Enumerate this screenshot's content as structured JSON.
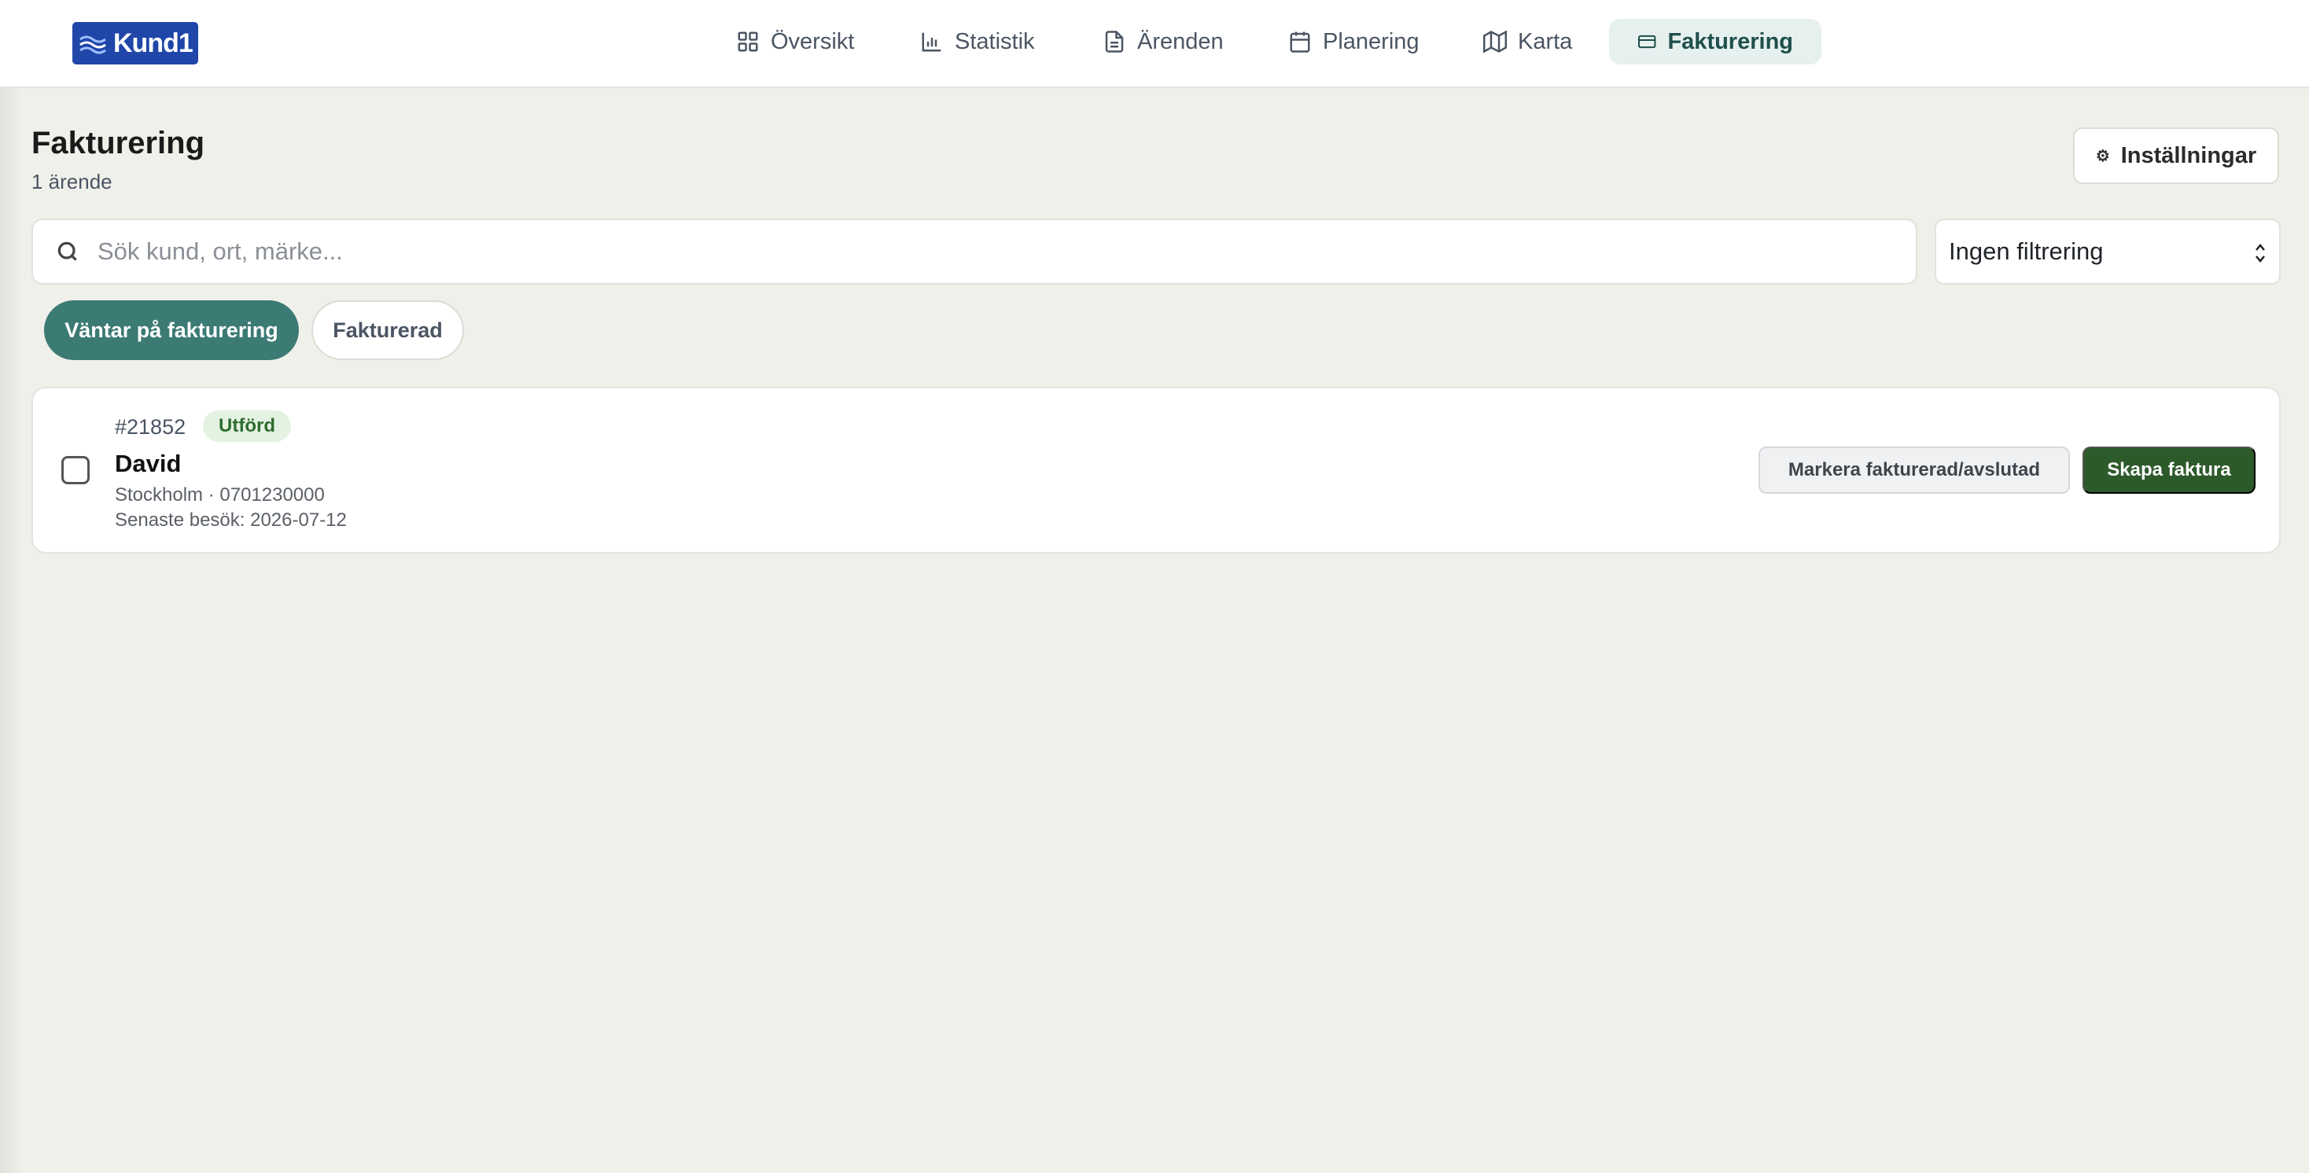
{
  "app": {
    "logo_text": "Kund1"
  },
  "nav": {
    "items": [
      {
        "label": "Översikt",
        "icon": "grid-icon"
      },
      {
        "label": "Statistik",
        "icon": "bar-chart-icon"
      },
      {
        "label": "Ärenden",
        "icon": "document-icon"
      },
      {
        "label": "Planering",
        "icon": "calendar-icon"
      },
      {
        "label": "Karta",
        "icon": "map-icon"
      },
      {
        "label": "Fakturering",
        "icon": "credit-card-icon",
        "active": true
      }
    ]
  },
  "page": {
    "title": "Fakturering",
    "count": "1 ärende",
    "settings_label": "Inställningar"
  },
  "search": {
    "placeholder": "Sök kund, ort, märke...",
    "value": ""
  },
  "filter": {
    "selected": "Ingen filtrering"
  },
  "tabs": [
    {
      "label": "Väntar på fakturering",
      "active": true
    },
    {
      "label": "Fakturerad",
      "active": false
    }
  ],
  "cases": [
    {
      "id": "#21852",
      "status": "Utförd",
      "name": "David",
      "location_phone": "Stockholm · 0701230000",
      "last_visit": "Senaste besök: 2026-07-12",
      "mark_label": "Markera fakturerad/avslutad",
      "create_label": "Skapa faktura"
    }
  ],
  "colors": {
    "accent": "#3c7a74",
    "nav_active_bg": "#e6f1ef",
    "primary_button": "#2d5a2a",
    "status_badge_bg": "#e3f2e1",
    "logo_bg": "#1f46a8",
    "page_bg": "#f0f0eb"
  }
}
